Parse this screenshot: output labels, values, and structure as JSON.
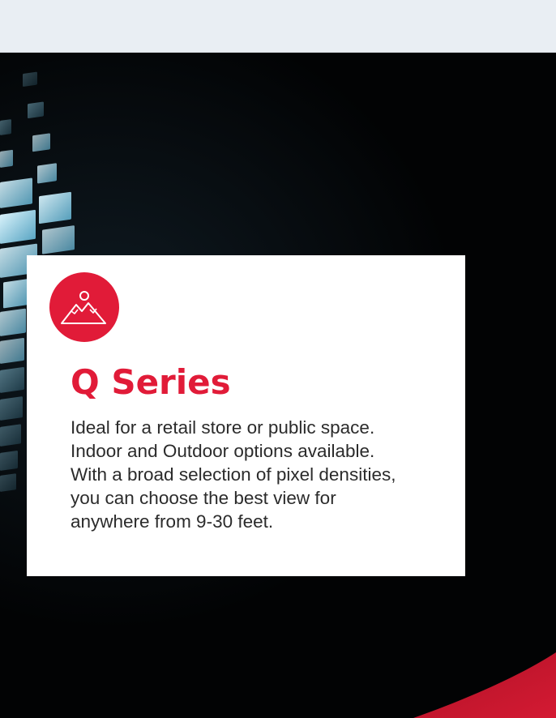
{
  "colors": {
    "accent": "#e11b38",
    "card_background": "#ffffff",
    "text": "#2b2b2b",
    "header_band": "#e9eef3",
    "hero_background": "#020304"
  },
  "card": {
    "icon": "mountains-sun-icon",
    "title": "Q Series",
    "description": "Ideal for a retail store or public space. Indoor and Outdoor options available. With a broad selection of pixel densities, you can choose the best view for anywhere from 9-30 feet."
  }
}
